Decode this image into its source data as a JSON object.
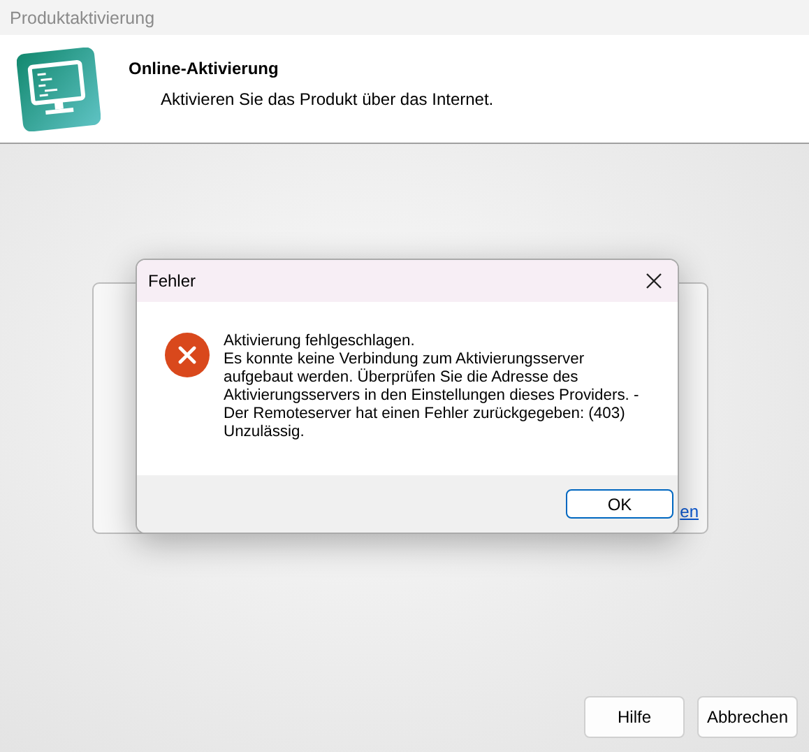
{
  "window": {
    "title": "Produktaktivierung"
  },
  "header": {
    "title": "Online-Aktivierung",
    "subtitle": "Aktivieren Sie das Produkt über das Internet."
  },
  "background_card": {
    "link": "en"
  },
  "error_dialog": {
    "title": "Fehler",
    "message_lines": [
      "Aktivierung fehlgeschlagen.",
      "Es konnte keine Verbindung zum Aktivierungsserver",
      "aufgebaut werden. Überprüfen Sie die Adresse des",
      "Aktivierungsservers in den Einstellungen dieses Providers. -",
      "Der Remoteserver hat einen Fehler zurückgegeben: (403)",
      "Unzulässig."
    ],
    "button": "OK"
  },
  "buttons": [
    "Hilfe",
    "Abbrechen"
  ]
}
